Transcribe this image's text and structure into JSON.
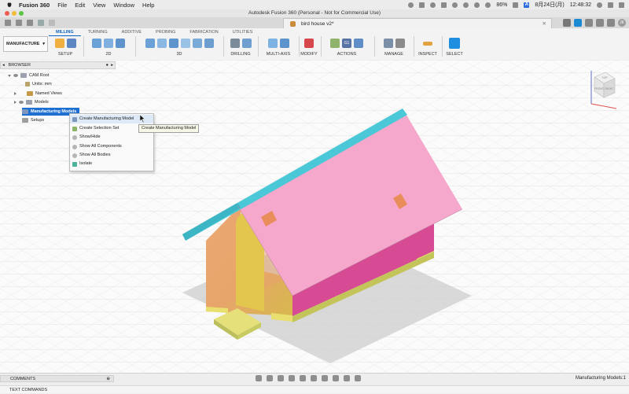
{
  "menubar": {
    "app": "Fusion 360",
    "items": [
      "File",
      "Edit",
      "View",
      "Window",
      "Help"
    ],
    "right": {
      "battery": "86%",
      "date": "8月24日(月)",
      "time": "12:48:32",
      "input": "A"
    }
  },
  "window": {
    "title": "Autodesk Fusion 360 (Personal - Not for Commercial Use)"
  },
  "doc_tab": {
    "label": "bird house v2*"
  },
  "profile": {
    "initials": "JK"
  },
  "ribbon": {
    "workspace": "MANUFACTURE",
    "tabs": [
      "MILLING",
      "TURNING",
      "ADDITIVE",
      "PROBING",
      "FABRICATION",
      "UTILITIES"
    ],
    "active_tab": "MILLING",
    "groups": [
      "SETUP",
      "2D",
      "3D",
      "DRILLING",
      "MULTI-AXIS",
      "MODIFY",
      "ACTIONS",
      "MANAGE",
      "INSPECT",
      "SELECT"
    ]
  },
  "browser": {
    "title": "BROWSER",
    "items": [
      {
        "label": "CAM Root"
      },
      {
        "label": "Units: mm"
      },
      {
        "label": "Named Views"
      },
      {
        "label": "Models"
      },
      {
        "label": "Manufacturing Models"
      },
      {
        "label": "Setups"
      }
    ]
  },
  "context_menu": {
    "items": [
      "Create Manufacturing Model",
      "Create Selection Set",
      "Show/Hide",
      "Show All Components",
      "Show All Bodies",
      "Isolate"
    ]
  },
  "tooltip": {
    "text": "Create Manufacturing Model"
  },
  "viewcube": {
    "top": "TOP",
    "front": "FRONT",
    "right": "RIGHT"
  },
  "bottom": {
    "comments": "COMMENTS",
    "text_commands": "TEXT COMMANDS",
    "status": "Manufacturing Models:1"
  },
  "colors": {
    "roof_top": "#f5a3c8",
    "roof_edge": "#4ac8d8",
    "walls": "#d64b93",
    "accent": "#1d6fd1"
  }
}
